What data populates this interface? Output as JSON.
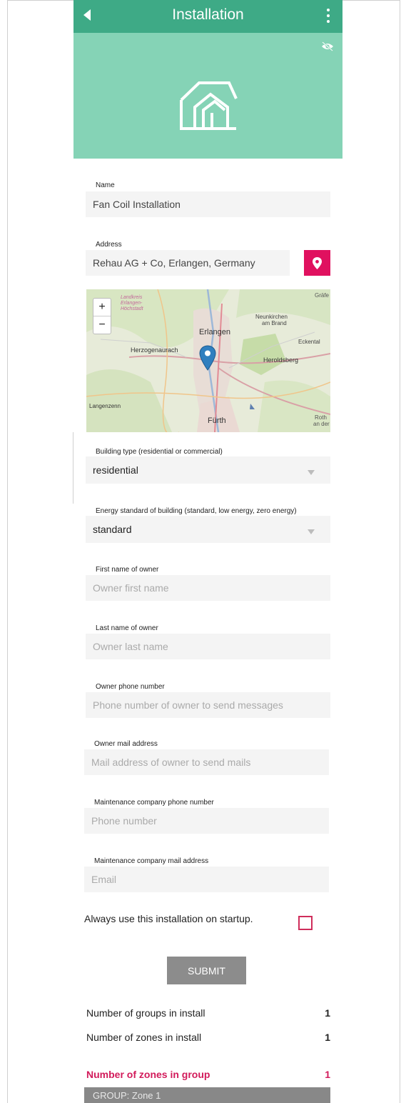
{
  "header": {
    "title": "Installation"
  },
  "form": {
    "name": {
      "label": "Name",
      "value": "Fan Coil Installation"
    },
    "address": {
      "label": "Address",
      "value": "Rehau AG + Co, Erlangen, Germany"
    },
    "map": {
      "labels": {
        "landkreis": "Landkreis",
        "erlangen_hoch": "Erlangen-",
        "hochstadt": "Höchstadt",
        "neunkirchen": "Neunkirchen",
        "am_brand": "am Brand",
        "erlangen": "Erlangen",
        "eckental": "Eckental",
        "herzogenaurach": "Herzogenaurach",
        "heroldsberg": "Heroldsberg",
        "langenzenn": "Langenzenn",
        "furth": "Fürth",
        "grafe": "Gräfe",
        "roth": "Roth",
        "an_der": "an der"
      },
      "zoom_in": "+",
      "zoom_out": "−"
    },
    "building_type": {
      "label": "Building type (residential or commercial)",
      "value": "residential"
    },
    "energy_standard": {
      "label": "Energy standard of building (standard, low energy, zero energy)",
      "value": "standard"
    },
    "owner_first": {
      "label": "First name of owner",
      "placeholder": "Owner first name"
    },
    "owner_last": {
      "label": "Last name of owner",
      "placeholder": "Owner last name"
    },
    "owner_phone": {
      "label": "Owner phone number",
      "placeholder": "Phone number of owner to send messages"
    },
    "owner_mail": {
      "label": "Owner mail address",
      "placeholder": "Mail address of owner to send mails"
    },
    "maint_phone": {
      "label": "Maintenance company phone number",
      "placeholder": "Phone number"
    },
    "maint_mail": {
      "label": "Maintenance company mail address",
      "placeholder": "Email"
    },
    "startup": {
      "label": "Always use this installation on startup.",
      "checked": false
    },
    "submit_label": "SUBMIT"
  },
  "stats": [
    {
      "label": "Number of groups in install",
      "value": "1"
    },
    {
      "label": "Number of zones in install",
      "value": "1"
    },
    {
      "label": "Number of zones in group",
      "value": "1"
    }
  ],
  "group_bar": "GROUP: Zone 1",
  "colors": {
    "appbar": "#3eaa86",
    "hero": "#85d3b6",
    "accent": "#e0115f",
    "submit": "#8c8c8c"
  }
}
